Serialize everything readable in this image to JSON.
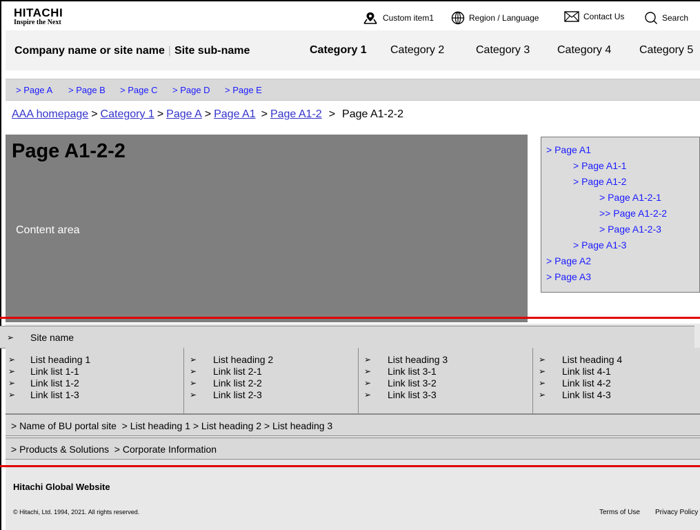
{
  "header": {
    "brand": "HITACHI",
    "tagline": "Inspire the Next",
    "utility": {
      "custom_item": "Custom item1",
      "region": "Region / Language",
      "contact": "Contact Us",
      "search": "Search"
    }
  },
  "nav": {
    "site_name": "Company name or site name",
    "site_sub_name": "Site sub-name",
    "categories": [
      "Category 1",
      "Category 2",
      "Category 3",
      "Category 4",
      "Category 5"
    ]
  },
  "subnav": [
    "> Page A",
    "> Page B",
    "> Page C",
    "> Page D",
    "> Page E"
  ],
  "breadcrumb": [
    "AAA homepage",
    "Category 1",
    "Page A",
    "Page A1",
    "Page A1-2",
    "Page A1-2-2"
  ],
  "content": {
    "title": "Page A1-2-2",
    "placeholder": "Content area"
  },
  "local_nav": [
    "> Page A1",
    "> Page A1-1",
    "> Page A1-2",
    "> Page A1-2-1",
    ">> Page A1-2-2",
    "> Page A1-2-3",
    "> Page A1-3",
    "> Page A2",
    "> Page A3"
  ],
  "footer": {
    "site_name": "Site name",
    "columns": [
      [
        "List heading 1",
        "Link list 1-1",
        "Link list 1-2",
        "Link list 1-3"
      ],
      [
        "List heading 2",
        "Link list 2-1",
        "Link list 2-2",
        "Link list 2-3"
      ],
      [
        "List heading 3",
        "Link list 3-1",
        "Link list 3-2",
        "Link list 3-3"
      ],
      [
        "List heading 4",
        "Link list 4-1",
        "Link list 4-2",
        "Link list 4-3"
      ]
    ],
    "bu_portal": "> Name of BU portal site  > List heading 1 > List heading 2 > List heading 3",
    "corporate": "> Products & Solutions  > Corporate Information",
    "global_site": "Hitachi Global Website",
    "copyright": "© Hitachi, Ltd. 1994, 2021. All rights reserved.",
    "terms": "Terms of Use",
    "privacy": "Privacy Policy"
  },
  "colors": {
    "link": "#1a1aff",
    "accent_line": "#e00000",
    "content_bg": "#7f7f7f"
  }
}
